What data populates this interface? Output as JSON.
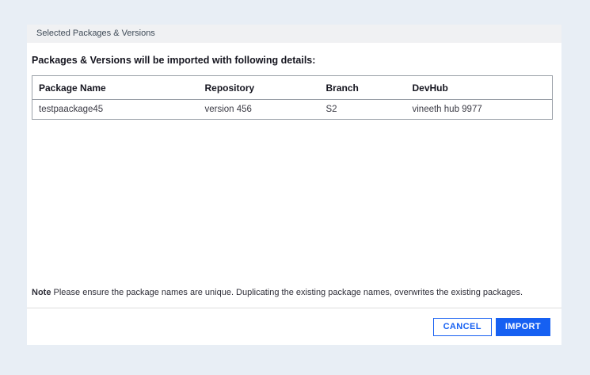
{
  "dialog": {
    "header": {
      "title": "Selected Packages & Versions"
    },
    "body": {
      "heading": "Packages & Versions will be imported with following details:",
      "table": {
        "columns": [
          "Package Name",
          "Repository",
          "Branch",
          "DevHub"
        ],
        "rows": [
          [
            "testpaackage45",
            "version 456",
            "S2",
            "vineeth hub 9977"
          ]
        ]
      },
      "note_label": "Note",
      "note_text": " Please ensure the package names are unique. Duplicating the existing package names, overwrites the existing packages."
    },
    "footer": {
      "cancel_label": "CANCEL",
      "import_label": "IMPORT"
    }
  },
  "colors": {
    "page_background": "#E8EEF5",
    "dialog_background": "#FFFFFF",
    "header_band_background": "#F0F1F3",
    "table_border": "#9AA0A8",
    "accent_blue": "#1660F2"
  }
}
